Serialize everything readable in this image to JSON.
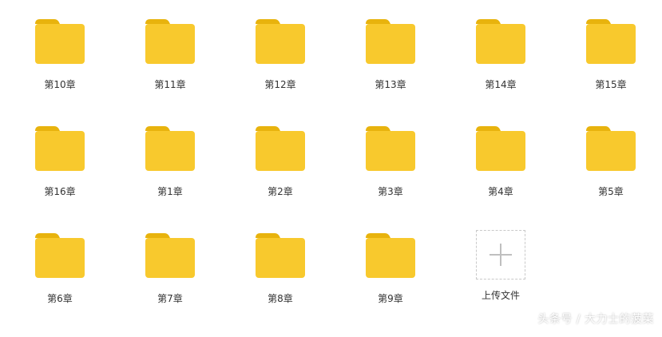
{
  "folders": [
    {
      "label": "第10章"
    },
    {
      "label": "第11章"
    },
    {
      "label": "第12章"
    },
    {
      "label": "第13章"
    },
    {
      "label": "第14章"
    },
    {
      "label": "第15章"
    },
    {
      "label": "第16章"
    },
    {
      "label": "第1章"
    },
    {
      "label": "第2章"
    },
    {
      "label": "第3章"
    },
    {
      "label": "第4章"
    },
    {
      "label": "第5章"
    },
    {
      "label": "第6章"
    },
    {
      "label": "第7章"
    },
    {
      "label": "第8章"
    },
    {
      "label": "第9章"
    }
  ],
  "upload": {
    "label": "上传文件",
    "icon": "plus-icon"
  },
  "watermark": "头条号 / 大力士的菠菜",
  "colors": {
    "folder_body": "#f8c92d",
    "folder_tab": "#e8b30d",
    "label_text": "#333333",
    "upload_border": "#c9c9c9",
    "upload_plus": "#bfbfbf"
  }
}
